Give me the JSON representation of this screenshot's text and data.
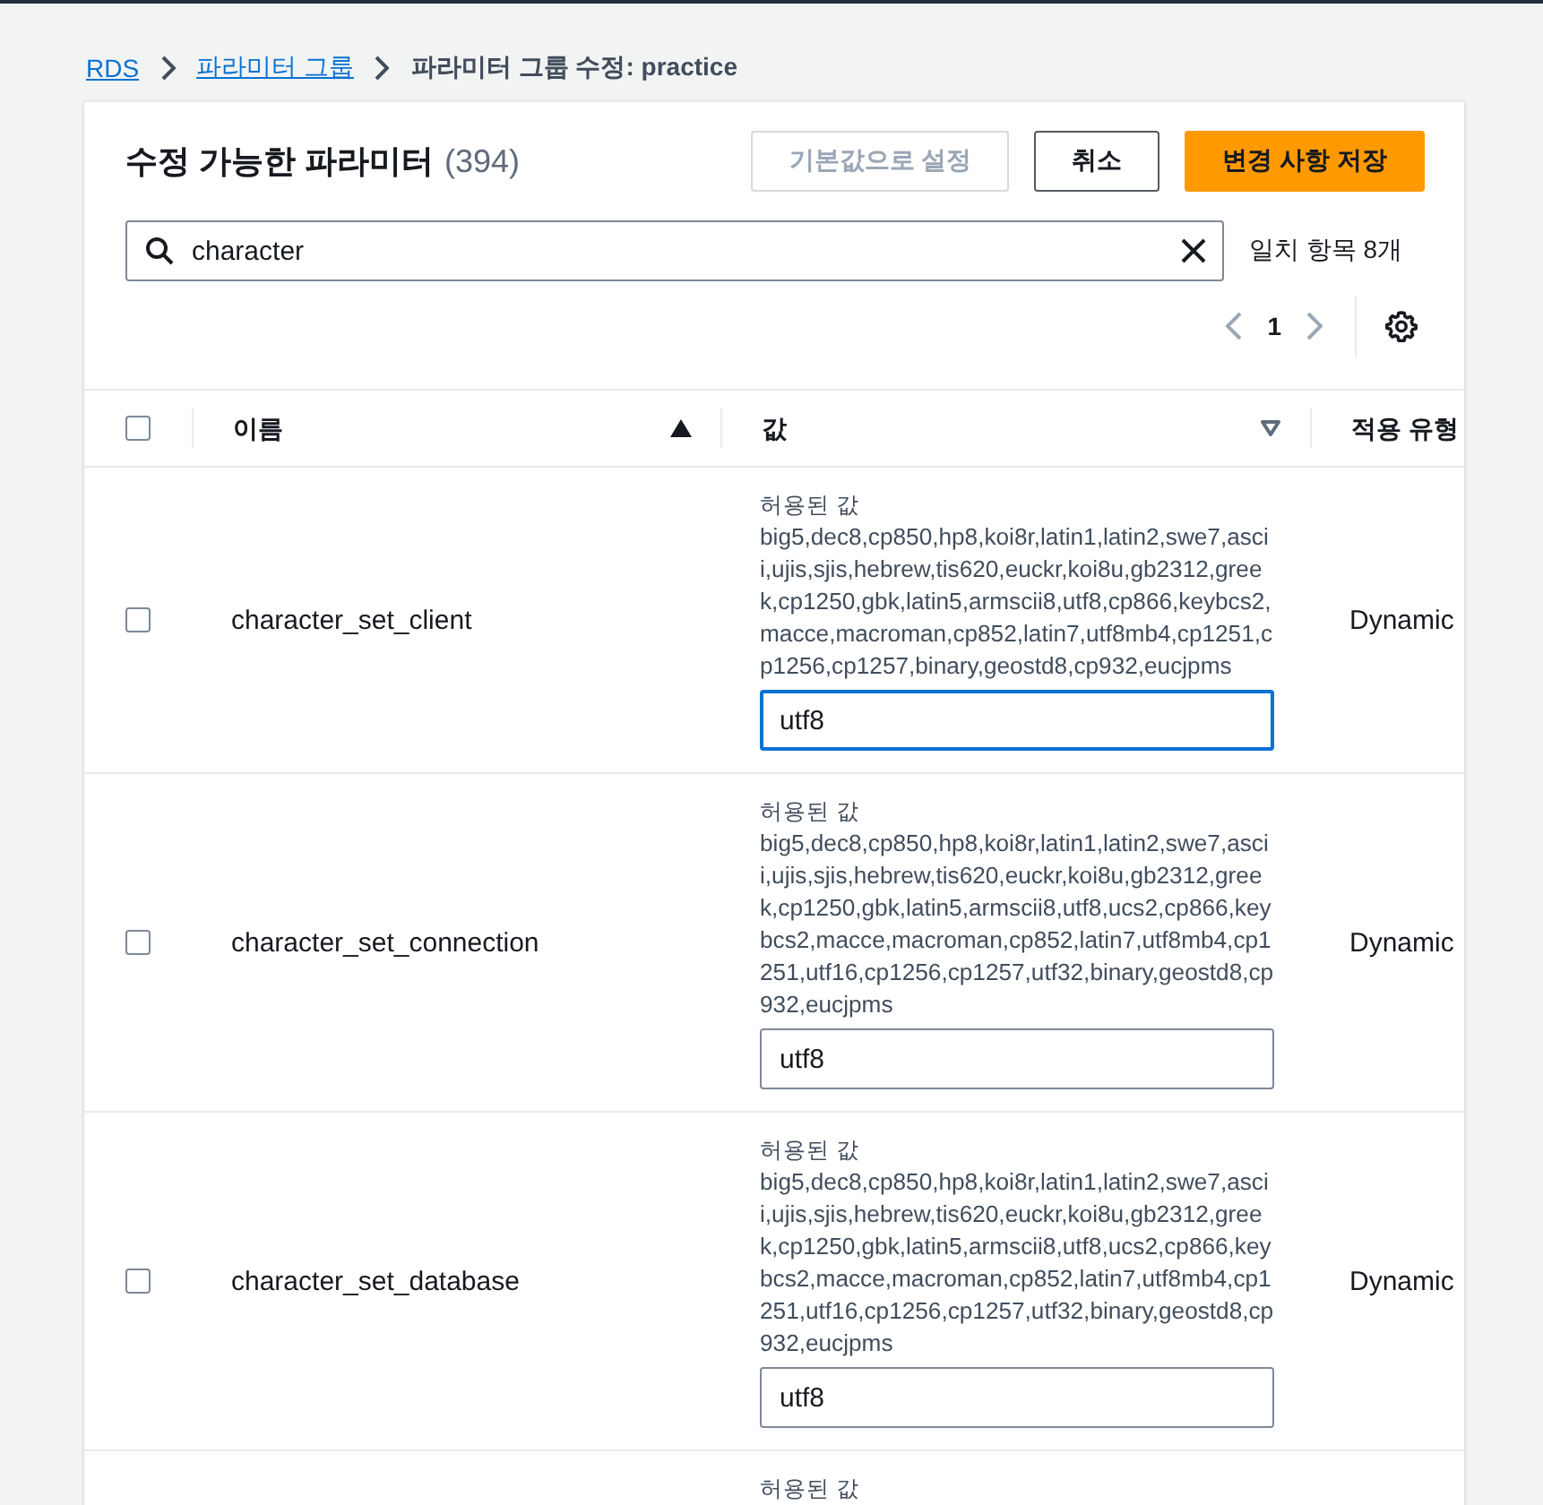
{
  "breadcrumb": [
    {
      "label": "RDS",
      "kind": "link"
    },
    {
      "label": "파라미터 그룹",
      "kind": "link"
    },
    {
      "label": "파라미터 그룹 수정: practice",
      "kind": "current"
    }
  ],
  "panel": {
    "title": "수정 가능한 파라미터",
    "count": "(394)",
    "buttons": [
      {
        "label": "기본값으로 설정",
        "kind": "normal",
        "disabled": true
      },
      {
        "label": "취소",
        "kind": "normal",
        "disabled": false
      },
      {
        "label": "변경 사항 저장",
        "kind": "primary",
        "disabled": false
      }
    ],
    "search": {
      "value": "character"
    },
    "match_count": "일치 항목 8개",
    "pagination": {
      "page": "1"
    }
  },
  "table": {
    "columns": [
      {
        "label": "이름",
        "sorted": true
      },
      {
        "label": "값",
        "sorted": false
      },
      {
        "label": "적용 유형"
      }
    ],
    "select_all": {
      "checked": false
    },
    "rows": [
      {
        "name": "character_set_client",
        "checked": false,
        "allowed_label": "허용된 값",
        "allowed_values": "big5,dec8,cp850,hp8,koi8r,latin1,latin2,swe7,ascii,ujis,sjis,hebrew,tis620,euckr,koi8u,gb2312,greek,cp1250,gbk,latin5,armscii8,utf8,cp866,keybcs2,macce,macroman,cp852,latin7,utf8mb4,cp1251,cp1256,cp1257,binary,geostd8,cp932,eucjpms",
        "value": "utf8",
        "focused": true,
        "apply_type": "Dynamic"
      },
      {
        "name": "character_set_connection",
        "checked": false,
        "allowed_label": "허용된 값",
        "allowed_values": "big5,dec8,cp850,hp8,koi8r,latin1,latin2,swe7,ascii,ujis,sjis,hebrew,tis620,euckr,koi8u,gb2312,greek,cp1250,gbk,latin5,armscii8,utf8,ucs2,cp866,keybcs2,macce,macroman,cp852,latin7,utf8mb4,cp1251,utf16,cp1256,cp1257,utf32,binary,geostd8,cp932,eucjpms",
        "value": "utf8",
        "focused": false,
        "apply_type": "Dynamic"
      },
      {
        "name": "character_set_database",
        "checked": false,
        "allowed_label": "허용된 값",
        "allowed_values": "big5,dec8,cp850,hp8,koi8r,latin1,latin2,swe7,ascii,ujis,sjis,hebrew,tis620,euckr,koi8u,gb2312,greek,cp1250,gbk,latin5,armscii8,utf8,ucs2,cp866,keybcs2,macce,macroman,cp852,latin7,utf8mb4,cp1251,utf16,cp1256,cp1257,utf32,binary,geostd8,cp932,eucjpms",
        "value": "utf8",
        "focused": false,
        "apply_type": "Dynamic"
      },
      {
        "allowed_label": "허용된 값"
      }
    ]
  }
}
